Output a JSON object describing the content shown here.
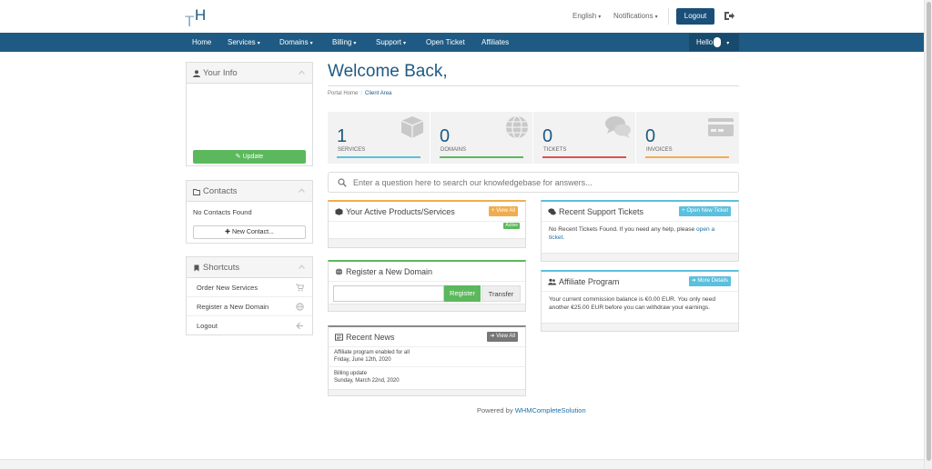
{
  "header": {
    "logo_text": "TH",
    "language": "English",
    "notifications": "Notifications",
    "logout": "Logout"
  },
  "nav": {
    "items": [
      "Home",
      "Services",
      "Domains",
      "Billing",
      "Support",
      "Open Ticket",
      "Affiliates"
    ],
    "hello": "Hello"
  },
  "sidebar": {
    "your_info": {
      "title": "Your Info",
      "update": "Update"
    },
    "contacts": {
      "title": "Contacts",
      "empty": "No Contacts Found",
      "new_contact": "New Contact..."
    },
    "shortcuts": {
      "title": "Shortcuts",
      "items": [
        "Order New Services",
        "Register a New Domain",
        "Logout"
      ]
    }
  },
  "main": {
    "welcome": "Welcome Back,",
    "breadcrumb": [
      "Portal Home",
      "Client Area"
    ],
    "stats": [
      {
        "value": "1",
        "label": "SERVICES",
        "color": "#5bc0de"
      },
      {
        "value": "0",
        "label": "DOMAINS",
        "color": "#5cb85c"
      },
      {
        "value": "0",
        "label": "TICKETS",
        "color": "#d9534f"
      },
      {
        "value": "0",
        "label": "INVOICES",
        "color": "#f0ad4e"
      }
    ],
    "kb_placeholder": "Enter a question here to search our knowledgebase for answers...",
    "products": {
      "title": "Your Active Products/Services",
      "view_all": "View All",
      "status": "Active"
    },
    "register_domain": {
      "title": "Register a New Domain",
      "register": "Register",
      "transfer": "Transfer"
    },
    "news": {
      "title": "Recent News",
      "view_all": "View All",
      "items": [
        {
          "title": "Affiliate program enabled for all",
          "date": "Friday, June 12th, 2020"
        },
        {
          "title": "Billing update",
          "date": "Sunday, March 22nd, 2020"
        }
      ]
    },
    "tickets": {
      "title": "Recent Support Tickets",
      "open_new": "Open New Ticket",
      "text": "No Recent Tickets Found. If you need any help, please",
      "link": "open a ticket",
      "tail": "."
    },
    "affiliate": {
      "title": "Affiliate Program",
      "more": "More Details",
      "text": "Your current commission balance is €0.00 EUR. You only need another €25.00 EUR before you can withdraw your earnings."
    }
  },
  "footer": {
    "powered_by": "Powered by",
    "link": "WHMCompleteSolution"
  },
  "colors": {
    "brand": "#1e5a83",
    "green": "#5cb85c",
    "orange": "#f0ad4e",
    "teal": "#5bc0de",
    "grey_btn": "#777777"
  }
}
